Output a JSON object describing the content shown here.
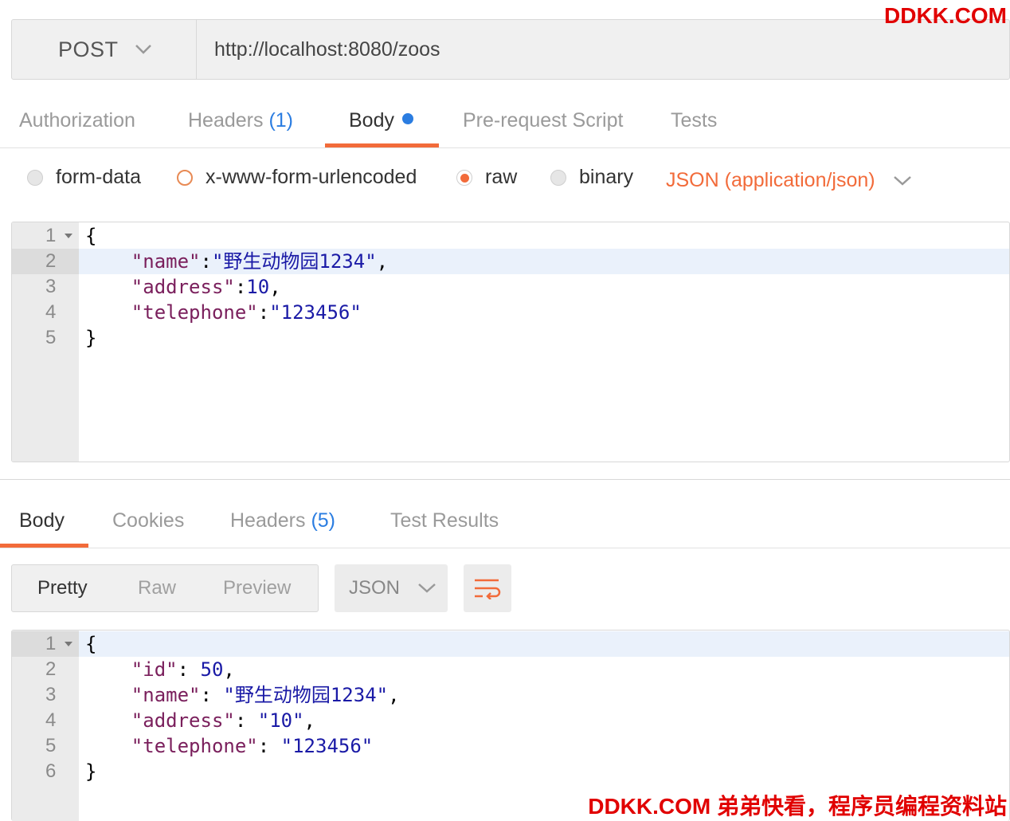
{
  "request": {
    "method": "POST",
    "url": "http://localhost:8080/zoos"
  },
  "request_tabs": [
    {
      "label": "Authorization"
    },
    {
      "label": "Headers",
      "count": "(1)"
    },
    {
      "label": "Body",
      "active": true,
      "dot": true
    },
    {
      "label": "Pre-request Script"
    },
    {
      "label": "Tests"
    }
  ],
  "body_types": {
    "form_data": "form-data",
    "urlencoded": "x-www-form-urlencoded",
    "raw": "raw",
    "binary": "binary",
    "selected": "raw",
    "content_type": "JSON (application/json)"
  },
  "request_body": {
    "line_numbers": [
      "1",
      "2",
      "3",
      "4",
      "5"
    ],
    "lines": [
      {
        "tokens": [
          {
            "t": "{",
            "c": "p"
          }
        ]
      },
      {
        "tokens": [
          {
            "t": "    ",
            "c": "p"
          },
          {
            "t": "\"name\"",
            "c": "k"
          },
          {
            "t": ":",
            "c": "p"
          },
          {
            "t": "\"野生动物园1234\"",
            "c": "s"
          },
          {
            "t": ",",
            "c": "p"
          }
        ]
      },
      {
        "tokens": [
          {
            "t": "    ",
            "c": "p"
          },
          {
            "t": "\"address\"",
            "c": "k"
          },
          {
            "t": ":",
            "c": "p"
          },
          {
            "t": "10",
            "c": "n"
          },
          {
            "t": ",",
            "c": "p"
          }
        ]
      },
      {
        "tokens": [
          {
            "t": "    ",
            "c": "p"
          },
          {
            "t": "\"telephone\"",
            "c": "k"
          },
          {
            "t": ":",
            "c": "p"
          },
          {
            "t": "\"123456\"",
            "c": "s"
          }
        ]
      },
      {
        "tokens": [
          {
            "t": "}",
            "c": "p"
          }
        ]
      }
    ]
  },
  "response_tabs": [
    {
      "label": "Body",
      "active": true
    },
    {
      "label": "Cookies"
    },
    {
      "label": "Headers",
      "count": "(5)"
    },
    {
      "label": "Test Results"
    }
  ],
  "response_view": {
    "modes": [
      "Pretty",
      "Raw",
      "Preview"
    ],
    "selected_mode": "Pretty",
    "format": "JSON",
    "wrap_icon": "wrap-lines-icon"
  },
  "response_body": {
    "line_numbers": [
      "1",
      "2",
      "3",
      "4",
      "5",
      "6"
    ],
    "lines": [
      {
        "tokens": [
          {
            "t": "{",
            "c": "p"
          }
        ]
      },
      {
        "tokens": [
          {
            "t": "    ",
            "c": "p"
          },
          {
            "t": "\"id\"",
            "c": "k"
          },
          {
            "t": ": ",
            "c": "p"
          },
          {
            "t": "50",
            "c": "n"
          },
          {
            "t": ",",
            "c": "p"
          }
        ]
      },
      {
        "tokens": [
          {
            "t": "    ",
            "c": "p"
          },
          {
            "t": "\"name\"",
            "c": "k"
          },
          {
            "t": ": ",
            "c": "p"
          },
          {
            "t": "\"野生动物园1234\"",
            "c": "s"
          },
          {
            "t": ",",
            "c": "p"
          }
        ]
      },
      {
        "tokens": [
          {
            "t": "    ",
            "c": "p"
          },
          {
            "t": "\"address\"",
            "c": "k"
          },
          {
            "t": ": ",
            "c": "p"
          },
          {
            "t": "\"10\"",
            "c": "s"
          },
          {
            "t": ",",
            "c": "p"
          }
        ]
      },
      {
        "tokens": [
          {
            "t": "    ",
            "c": "p"
          },
          {
            "t": "\"telephone\"",
            "c": "k"
          },
          {
            "t": ": ",
            "c": "p"
          },
          {
            "t": "\"123456\"",
            "c": "s"
          }
        ]
      },
      {
        "tokens": [
          {
            "t": "}",
            "c": "p"
          }
        ]
      }
    ]
  },
  "watermarks": {
    "top": "DDKK.COM",
    "bottom": "DDKK.COM 弟弟快看，程序员编程资料站"
  },
  "colors": {
    "accent": "#f26b3a",
    "link_blue": "#2b7de1",
    "watermark": "#e10000"
  }
}
